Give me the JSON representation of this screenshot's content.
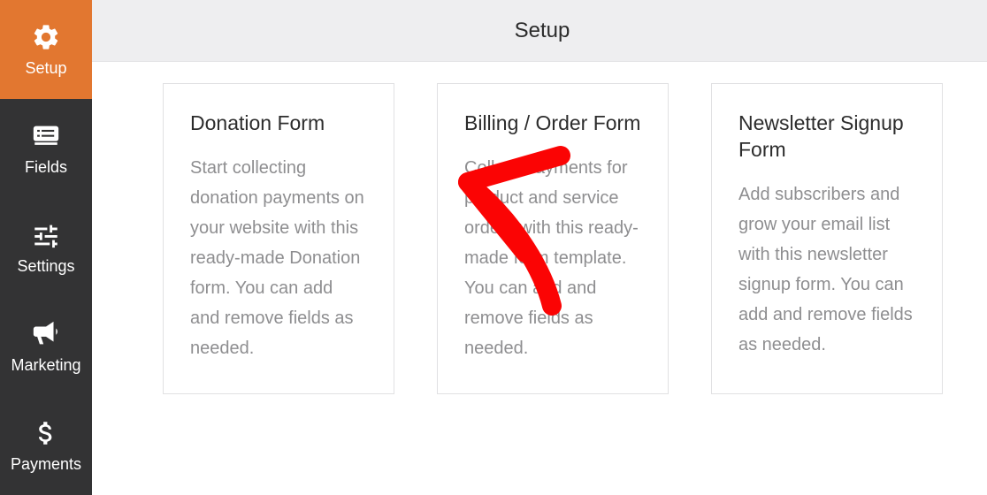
{
  "sidebar": {
    "items": [
      {
        "label": "Setup",
        "icon": "gear-icon",
        "active": true
      },
      {
        "label": "Fields",
        "icon": "list-icon",
        "active": false
      },
      {
        "label": "Settings",
        "icon": "sliders-icon",
        "active": false
      },
      {
        "label": "Marketing",
        "icon": "bullhorn-icon",
        "active": false
      },
      {
        "label": "Payments",
        "icon": "dollar-icon",
        "active": false
      }
    ]
  },
  "header": {
    "title": "Setup"
  },
  "cards": [
    {
      "title": "Donation Form",
      "description": "Start collecting donation payments on your website with this ready-made Donation form. You can add and remove fields as needed."
    },
    {
      "title": "Billing / Order Form",
      "description": "Collect Payments for product and service orders with this ready-made form template. You can add and remove fields as needed."
    },
    {
      "title": "Newsletter Signup Form",
      "description": "Add subscribers and grow your email list with this newsletter signup form. You can add and remove fields as needed."
    }
  ],
  "annotation": {
    "color": "#fb0404"
  }
}
